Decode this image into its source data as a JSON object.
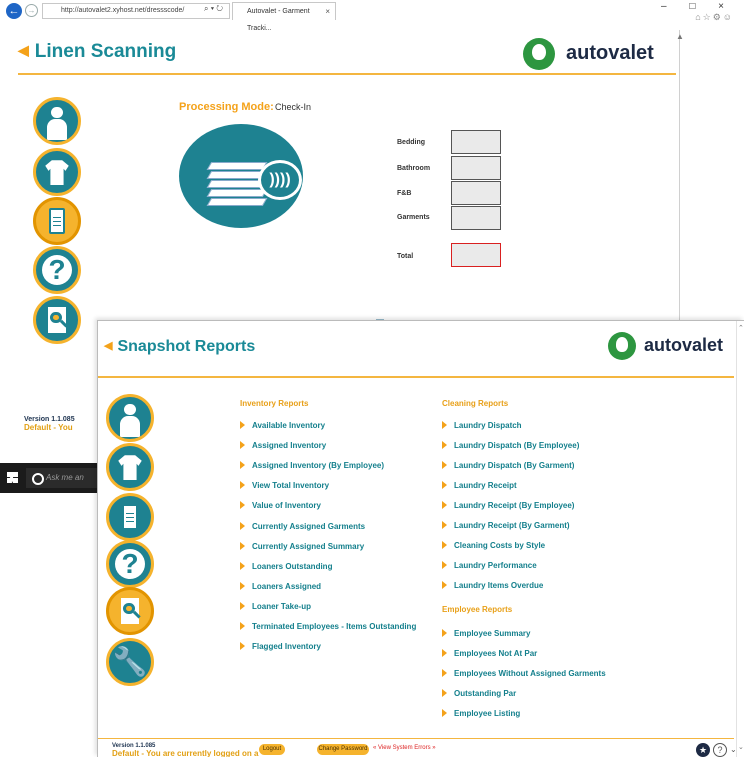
{
  "browser": {
    "url": "http://autovalet2.xyhost.net/dressscode/",
    "url_tools": "⌕ ▾ ↻",
    "tab_title": "Autovalet - Garment Tracki...",
    "tab_close": "×",
    "window_controls": "– □ ×",
    "toolbar_icons": "⌂☆⚙☺"
  },
  "linen": {
    "title": "Linen Scanning",
    "brand": "autovalet",
    "processing_mode_label": "Processing Mode:",
    "processing_mode_value": "Check-In",
    "rfid_glyph": "))))",
    "rows": [
      {
        "label": "Bedding",
        "value": ""
      },
      {
        "label": "Bathroom",
        "value": ""
      },
      {
        "label": "F&B",
        "value": ""
      },
      {
        "label": "Garments",
        "value": ""
      },
      {
        "label": "Total",
        "value": ""
      }
    ],
    "version": "Version 1.1.085",
    "user_banner": "Default - You"
  },
  "taskbar": {
    "search_placeholder": "Ask me an"
  },
  "snapshot": {
    "title": "Snapshot Reports",
    "brand": "autovalet",
    "inventory_header": "Inventory Reports",
    "inventory": [
      "Available Inventory",
      "Assigned Inventory",
      "Assigned Inventory (By Employee)",
      "View Total Inventory",
      "Value of Inventory",
      "Currently Assigned Garments",
      "Currently Assigned Summary",
      "Loaners Outstanding",
      "Loaners Assigned",
      "Loaner Take-up",
      "Terminated Employees - Items Outstanding",
      "Flagged Inventory"
    ],
    "cleaning_header": "Cleaning Reports",
    "cleaning": [
      "Laundry Dispatch",
      "Laundry Dispatch (By Employee)",
      "Laundry Dispatch (By Garment)",
      "Laundry Receipt",
      "Laundry Receipt (By Employee)",
      "Laundry Receipt (By Garment)",
      "Cleaning Costs by Style",
      "Laundry Performance",
      "Laundry Items Overdue"
    ],
    "employee_header": "Employee Reports",
    "employee": [
      "Employee Summary",
      "Employees Not At Par",
      "Employees Without Assigned Garments",
      "Outstanding Par",
      "Employee Listing"
    ],
    "version": "Version 1.1.085",
    "user_banner": "Default - You are currently logged on a",
    "logout": "Logout",
    "change_password": "Change Password",
    "system_errors": "« View System Errors »"
  },
  "colors": {
    "teal": "#1a8a97",
    "orange": "#f4a21a",
    "brand_green": "#2d9640",
    "navy": "#1d2a44"
  },
  "icons": {
    "side": [
      "person-icon",
      "shirt-icon",
      "clipboard-icon",
      "help-icon",
      "search-report-icon",
      "wrench-icon"
    ]
  }
}
